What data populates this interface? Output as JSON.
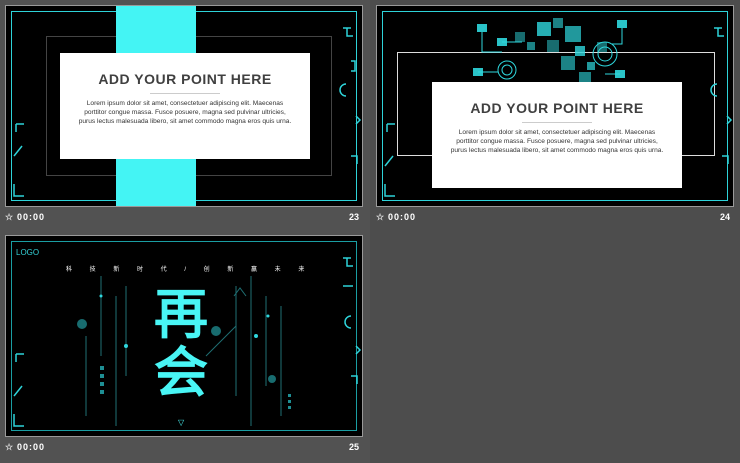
{
  "slides": [
    {
      "number": "23",
      "time": "00:00",
      "heading": "ADD YOUR POINT HERE",
      "body": "Lorem ipsum dolor sit  amet, consectetuer adipiscing elit. Maecenas porttitor congue massa. Fusce posuere, magna sed pulvinar ultricies,  purus lectus malesuada libero, sit amet commodo magna eros quis urna."
    },
    {
      "number": "24",
      "time": "00:00",
      "heading": "ADD YOUR POINT HERE",
      "body": "Lorem ipsum dolor sit  amet, consectetuer adipiscing elit. Maecenas porttitor congue massa. Fusce posuere, magna sed pulvinar ultricies,  purus lectus malesuada libero, sit amet commodo magna eros quis urna."
    },
    {
      "number": "25",
      "time": "00:00",
      "logo": "LOGO",
      "tagline": "科 技 新 时 代 / 创 新 赢 未 来",
      "big_text": "再会"
    }
  ],
  "colors": {
    "accent": "#44f4f4",
    "frame": "#2ed3d9",
    "background": "#4a4a4a"
  },
  "icons": {
    "footer": "star-icon"
  }
}
